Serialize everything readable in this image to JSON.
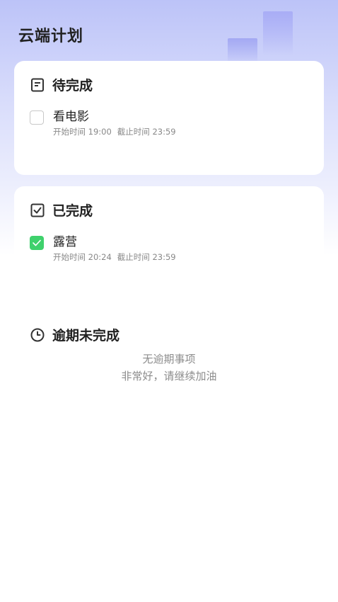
{
  "header": {
    "title": "云端计划"
  },
  "pending": {
    "title": "待完成",
    "icon": "list-doc-icon",
    "tasks": [
      {
        "title": "看电影",
        "start": "开始时间 19:00",
        "end": "截止时间 23:59",
        "checked": false
      }
    ]
  },
  "done": {
    "title": "已完成",
    "icon": "checkbox-checked-icon",
    "tasks": [
      {
        "title": "露营",
        "start": "开始时间 20:24",
        "end": "截止时间 23:59",
        "checked": true
      }
    ]
  },
  "overdue": {
    "title": "逾期未完成",
    "icon": "clock-icon",
    "empty_line1": "无逾期事项",
    "empty_line2": "非常好，请继续加油"
  },
  "colors": {
    "accent_check": "#3fd16c",
    "header_gradient_top": "#bcc3f8"
  }
}
